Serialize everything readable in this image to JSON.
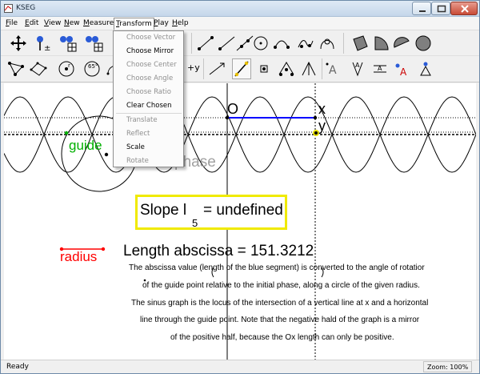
{
  "window": {
    "title": "KSEG"
  },
  "menubar": {
    "items": [
      {
        "label": "File",
        "mnemonic": "F",
        "rest": "ile"
      },
      {
        "label": "Edit",
        "mnemonic": "E",
        "rest": "dit"
      },
      {
        "label": "View",
        "mnemonic": "V",
        "rest": "iew"
      },
      {
        "label": "New",
        "mnemonic": "N",
        "rest": "ew"
      },
      {
        "label": "Measure",
        "mnemonic": "M",
        "rest": "easure"
      },
      {
        "label": "Transform",
        "mnemonic": "T",
        "rest": "ransform"
      },
      {
        "label": "Play",
        "mnemonic": "P",
        "rest": "lay"
      },
      {
        "label": "Help",
        "mnemonic": "H",
        "rest": "elp"
      }
    ]
  },
  "transform_menu": {
    "items": [
      {
        "label": "Choose Vector",
        "enabled": false
      },
      {
        "label": "Choose Mirror",
        "enabled": true
      },
      {
        "label": "Choose Center",
        "enabled": false
      },
      {
        "label": "Choose Angle",
        "enabled": false
      },
      {
        "label": "Choose Ratio",
        "enabled": false
      },
      {
        "label": "Clear Chosen",
        "enabled": true
      },
      {
        "label": "Translate",
        "enabled": false
      },
      {
        "label": "Reflect",
        "enabled": false
      },
      {
        "label": "Scale",
        "enabled": true
      },
      {
        "label": "Rotate",
        "enabled": false
      }
    ]
  },
  "toolbar": {
    "row2_text": {
      "x_tool": "x",
      "y_tool": "+y",
      "xy_tool": "x+y"
    }
  },
  "canvas": {
    "labels": {
      "origin": "O",
      "x_point": "x",
      "y_point": "y",
      "guide": "guide",
      "phase": "phase",
      "radius": "radius"
    },
    "slope": {
      "text": "Slope l",
      "subscript": "5",
      "value": "= undefined"
    },
    "length_measurement": "Length abscissa = 151.3212",
    "description": [
      "The abscissa value (length of the blue segment) is converted to the angle of rotatior",
      "of the guide point relative to the initial phase, along a circle of the given radius.",
      "The sinus graph is the locus of the intersection of a vertical line at x and a horizontal",
      "line through the guide point. Note that the negative hald of the graph is a mirror",
      "of the positive half, because the Ox length can only be positive."
    ],
    "colors": {
      "guide": "#00b000",
      "radius": "#ff0000",
      "segment": "#0000ff",
      "slope_border": "#f0ea00",
      "phase": "#a0a0a0"
    }
  },
  "statusbar": {
    "status": "Ready",
    "zoom": "Zoom: 100%"
  }
}
